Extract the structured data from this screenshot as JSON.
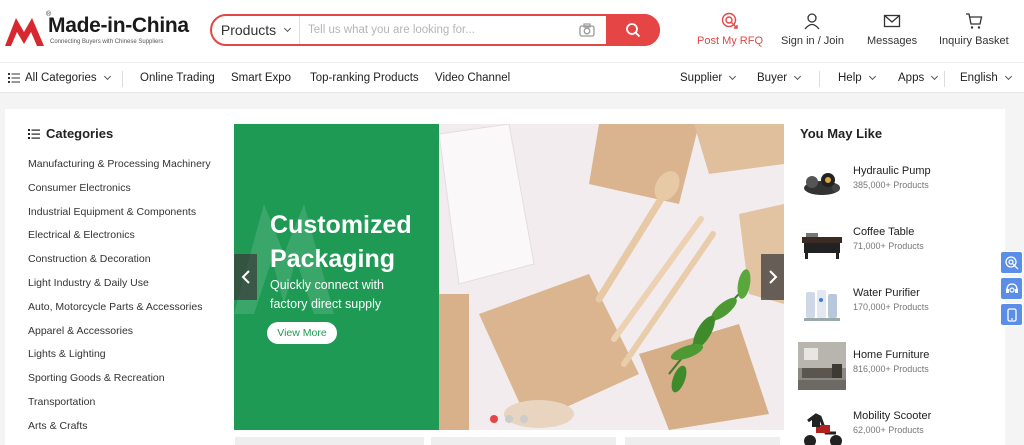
{
  "header": {
    "logo": {
      "name": "Made-in-China",
      "tagline": "Connecting Buyers with Chinese Suppliers",
      "mark_icon": "mic-logo-icon",
      "brand_color": "#d7282f"
    },
    "search": {
      "category": "Products",
      "placeholder": "Tell us what you are looking for...",
      "camera_icon": "camera-icon",
      "search_icon": "search-icon",
      "accent": "#e64545"
    },
    "actions": [
      {
        "label": "Post My RFQ",
        "icon": "rfq-icon"
      },
      {
        "label": "Sign in / Join",
        "icon": "user-icon"
      },
      {
        "label": "Messages",
        "icon": "envelope-icon"
      },
      {
        "label": "Inquiry Basket",
        "icon": "cart-icon"
      }
    ]
  },
  "nav": {
    "all_categories": "All Categories",
    "links": [
      "Online Trading",
      "Smart Expo",
      "Top-ranking Products",
      "Video Channel"
    ],
    "right": [
      "Supplier",
      "Buyer",
      "Help",
      "Apps",
      "English"
    ]
  },
  "categories": {
    "title": "Categories",
    "items": [
      "Manufacturing & Processing Machinery",
      "Consumer Electronics",
      "Industrial Equipment & Components",
      "Electrical & Electronics",
      "Construction & Decoration",
      "Light Industry & Daily Use",
      "Auto, Motorcycle Parts & Accessories",
      "Apparel & Accessories",
      "Lights & Lighting",
      "Sporting Goods & Recreation",
      "Transportation",
      "Arts & Crafts"
    ]
  },
  "banner": {
    "title": "Customized Packaging",
    "subtitle": "Quickly connect with factory direct supply",
    "button": "View More",
    "green": "#1f9a55",
    "slide_count": 3,
    "active_slide": 1
  },
  "you_may_like": {
    "title": "You May Like",
    "items": [
      {
        "name": "Hydraulic Pump",
        "count": "385,000+ Products"
      },
      {
        "name": "Coffee Table",
        "count": "71,000+ Products"
      },
      {
        "name": "Water Purifier",
        "count": "170,000+ Products"
      },
      {
        "name": "Home Furniture",
        "count": "816,000+ Products"
      },
      {
        "name": "Mobility Scooter",
        "count": "62,000+ Products"
      }
    ]
  },
  "side_tools": [
    "rfq-float-icon",
    "support-icon",
    "mobile-app-icon"
  ]
}
